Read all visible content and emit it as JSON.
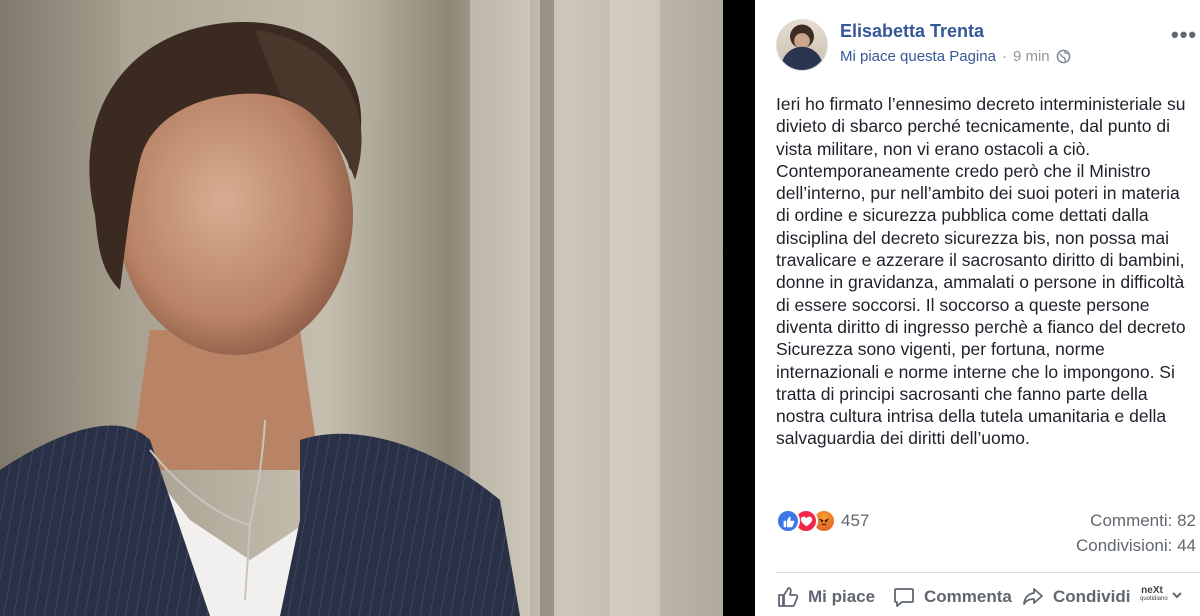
{
  "post": {
    "author": "Elisabetta Trenta",
    "like_page": "Mi piace questa Pagina",
    "separator": "·",
    "time": "9 min",
    "more": "•••",
    "text_lines": [
      "Ieri ho firmato l’ennesimo decreto interministeriale su",
      "divieto di sbarco perché tecnicamente, dal punto di",
      "vista militare, non vi erano ostacoli a ciò.",
      "Contemporaneamente credo però che il Ministro",
      "dell’interno, pur nell’ambito dei suoi poteri in materia",
      "di ordine e sicurezza pubblica come dettati dalla",
      "disciplina del decreto sicurezza bis, non possa mai",
      "travalicare e azzerare il sacrosanto diritto di bambini,",
      "donne in gravidanza, ammalati o persone in difficoltà",
      "di essere soccorsi. Il soccorso a queste persone",
      "diventa diritto di ingresso perchè a fianco del decreto",
      "Sicurezza sono vigenti, per fortuna, norme",
      "internazionali e norme interne che lo impongono. Si",
      "tratta di principi sacrosanti che fanno parte della",
      "nostra cultura intrisa della tutela umanitaria e della",
      "salvaguardia dei diritti dell’uomo."
    ]
  },
  "stats": {
    "reaction_icons": [
      "like-icon",
      "love-icon",
      "angry-icon"
    ],
    "reactions": "457",
    "comments": "Commenti: 82",
    "shares": "Condivisioni: 44"
  },
  "actions": {
    "like": "Mi piace",
    "comment": "Commenta",
    "share": "Condividi"
  },
  "watermark": {
    "brand": "neXt",
    "sub": "quotidiano"
  },
  "colors": {
    "link_blue": "#365899",
    "meta_gray": "#90949c",
    "body_text": "#1d2129",
    "action_gray": "#606770",
    "like_blue": "#3b77e6",
    "love_red": "#f0284a"
  }
}
